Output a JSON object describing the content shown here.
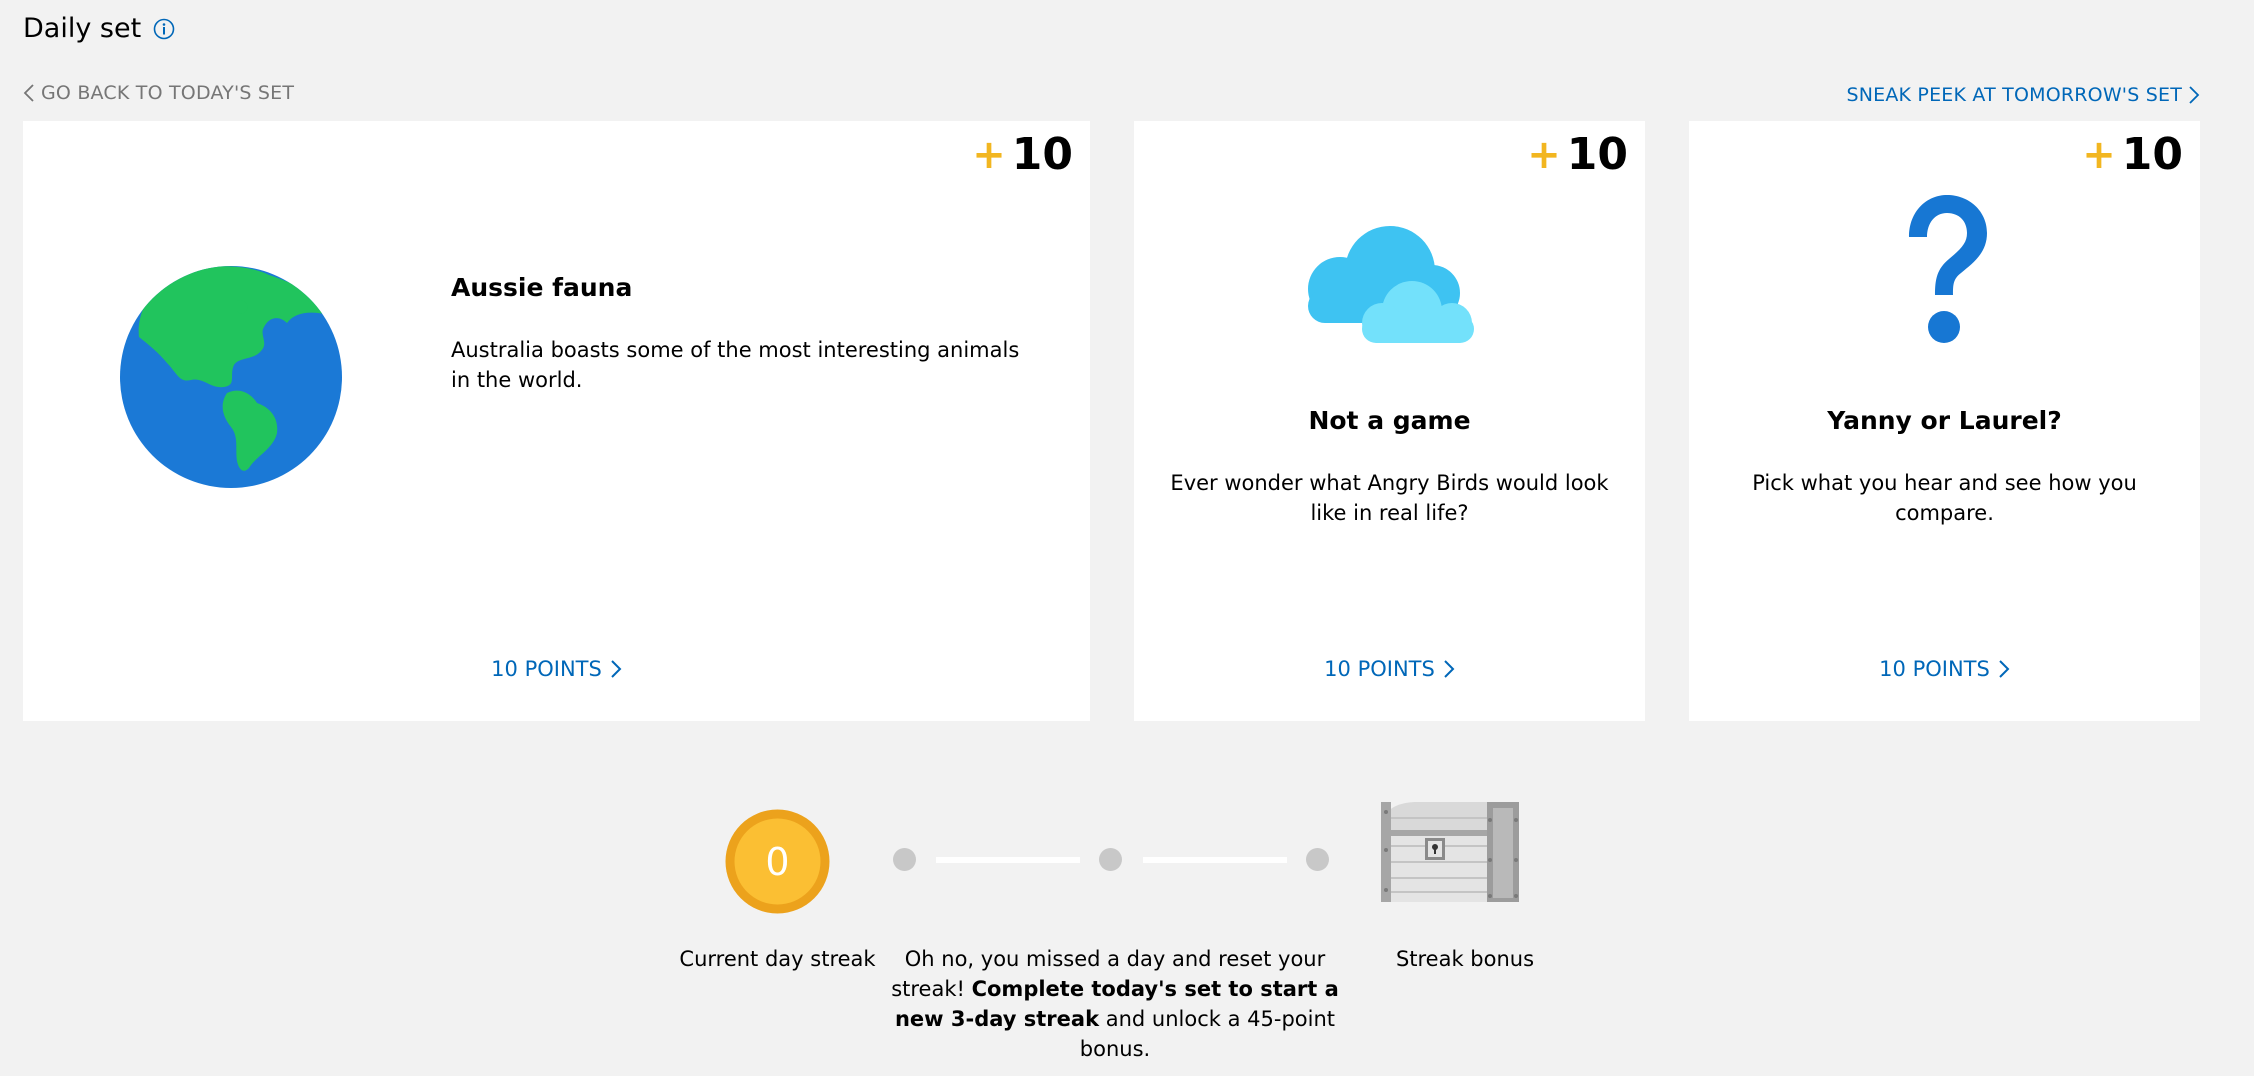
{
  "header": {
    "title": "Daily set",
    "back_label": "GO BACK TO TODAY'S SET",
    "next_label": "SNEAK PEEK AT TOMORROW'S SET"
  },
  "cards": [
    {
      "badge_plus": "+",
      "badge_points": "10",
      "icon": "globe-icon",
      "title": "Aussie fauna",
      "description": "Australia boasts some of the most interesting animals in the world.",
      "link": "10 POINTS"
    },
    {
      "badge_plus": "+",
      "badge_points": "10",
      "icon": "cloud-icon",
      "title": "Not a game",
      "description": "Ever wonder what Angry Birds would look like in real life?",
      "link": "10 POINTS"
    },
    {
      "badge_plus": "+",
      "badge_points": "10",
      "icon": "question-mark-icon",
      "title": "Yanny or Laurel?",
      "description": "Pick what you hear and see how you compare.",
      "link": "10 POINTS"
    }
  ],
  "streak": {
    "count": "0",
    "current_label": "Current day streak",
    "message_start": "Oh no, you missed a day and reset your streak! ",
    "message_bold": "Complete today's set to start a new 3-day streak",
    "message_end": " and unlock a 45-point bonus.",
    "bonus_label": "Streak bonus"
  },
  "colors": {
    "accent_blue": "#0067b8",
    "gold": "#f2b620",
    "background": "#f2f2f2"
  }
}
